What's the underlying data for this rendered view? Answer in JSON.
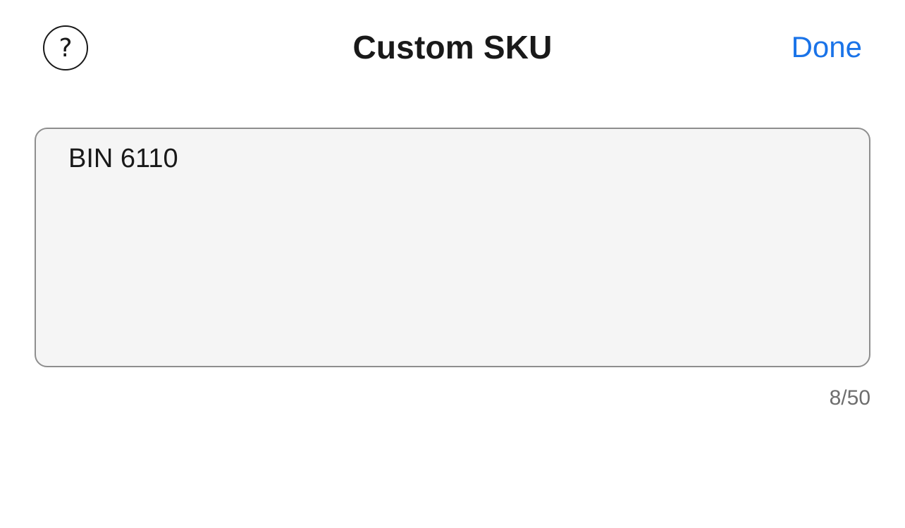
{
  "header": {
    "title": "Custom SKU",
    "help_icon": "question-circle-icon",
    "help_glyph": "?",
    "done_label": "Done",
    "accent_color": "#1a73e8"
  },
  "sku_input": {
    "value": "BIN 6110"
  },
  "counter": {
    "text": "8/50"
  }
}
